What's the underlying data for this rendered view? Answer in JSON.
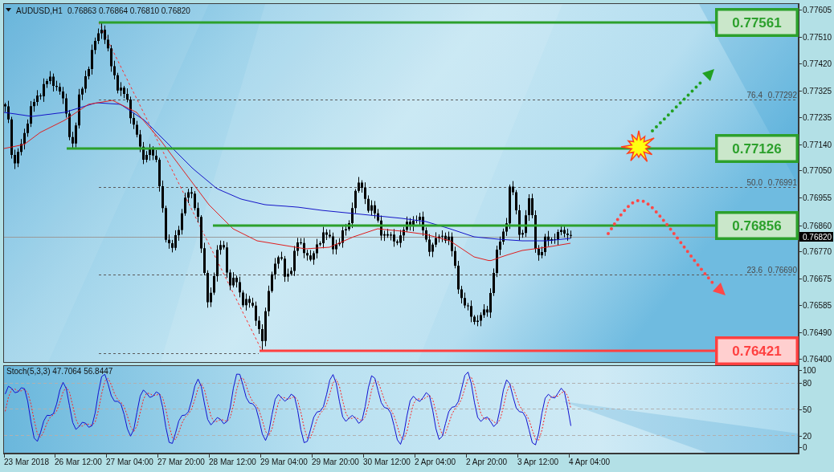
{
  "chart_header": {
    "symbol": "AUDUSD,H1",
    "quotes": "0.76863 0.76864 0.76810 0.76820"
  },
  "price_levels": [
    {
      "price": "0.77561",
      "color": "#2ca02c"
    },
    {
      "price": "0.77126",
      "color": "#2ca02c"
    },
    {
      "price": "0.76856",
      "color": "#2ca02c"
    },
    {
      "price": "0.76421",
      "color": "#ff4040"
    }
  ],
  "fibonacci_levels": [
    {
      "ratio": "76.4",
      "price": "0.77292"
    },
    {
      "ratio": "50.0",
      "price": "0.76991"
    },
    {
      "ratio": "23.6",
      "price": "0.76690"
    }
  ],
  "price_axis": {
    "labels": [
      "0.77605",
      "0.77510",
      "0.77420",
      "0.77325",
      "0.77235",
      "0.77140",
      "0.77050",
      "0.76955",
      "0.76860",
      "0.76770",
      "0.76675",
      "0.76585",
      "0.76490",
      "0.76400"
    ],
    "current_price": "0.76820"
  },
  "indicator": {
    "title": "Stoch(5,3,3) 47.7064 56.8447",
    "axis_labels": [
      "100",
      "80",
      "50",
      "20",
      "0"
    ]
  },
  "time_axis": {
    "labels": [
      "23 Mar 2018",
      "26 Mar 12:00",
      "27 Mar 04:00",
      "27 Mar 20:00",
      "28 Mar 12:00",
      "29 Mar 04:00",
      "29 Mar 20:00",
      "30 Mar 12:00",
      "2 Apr 04:00",
      "2 Apr 20:00",
      "3 Apr 12:00",
      "4 Apr 04:00"
    ]
  }
}
